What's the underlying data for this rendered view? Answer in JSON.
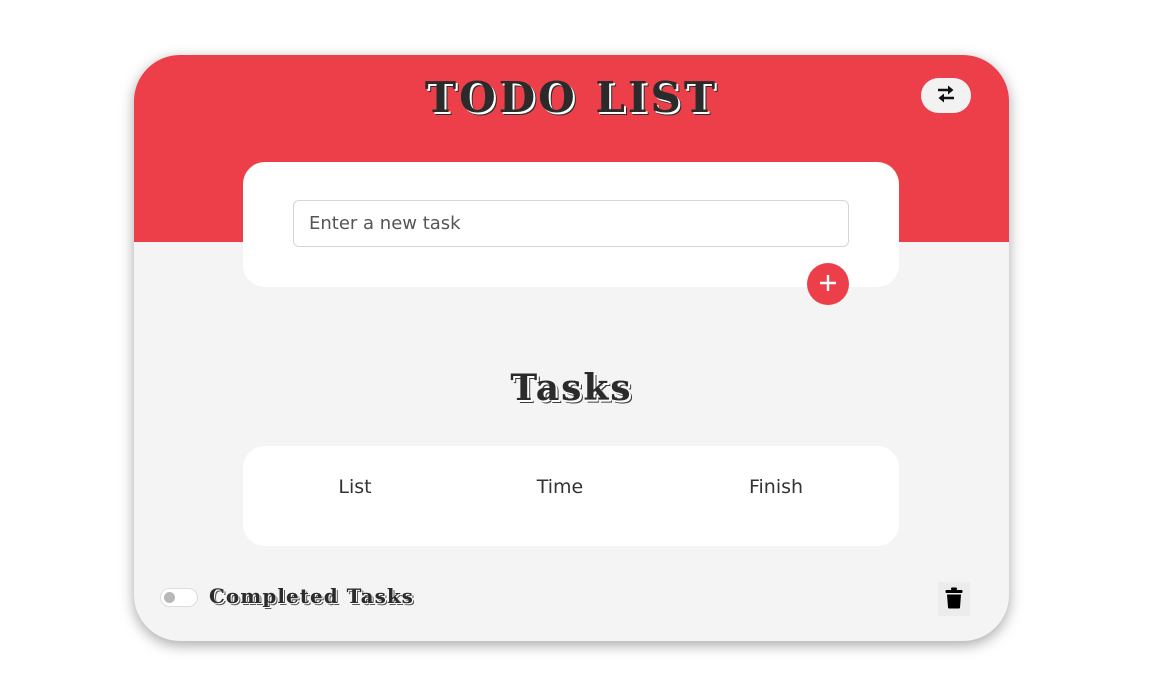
{
  "app": {
    "title": "TODO LIST",
    "accent_color": "#ec3f4a",
    "swap_icon": "swap-arrows-icon"
  },
  "new_task": {
    "placeholder": "Enter a new task",
    "value": "",
    "add_icon": "plus-icon"
  },
  "tasks": {
    "title": "Tasks",
    "columns": [
      "List",
      "Time",
      "Finish"
    ],
    "rows": []
  },
  "footer": {
    "toggle_label": "Completed Tasks",
    "toggle_on": false,
    "delete_icon": "trash-icon"
  }
}
